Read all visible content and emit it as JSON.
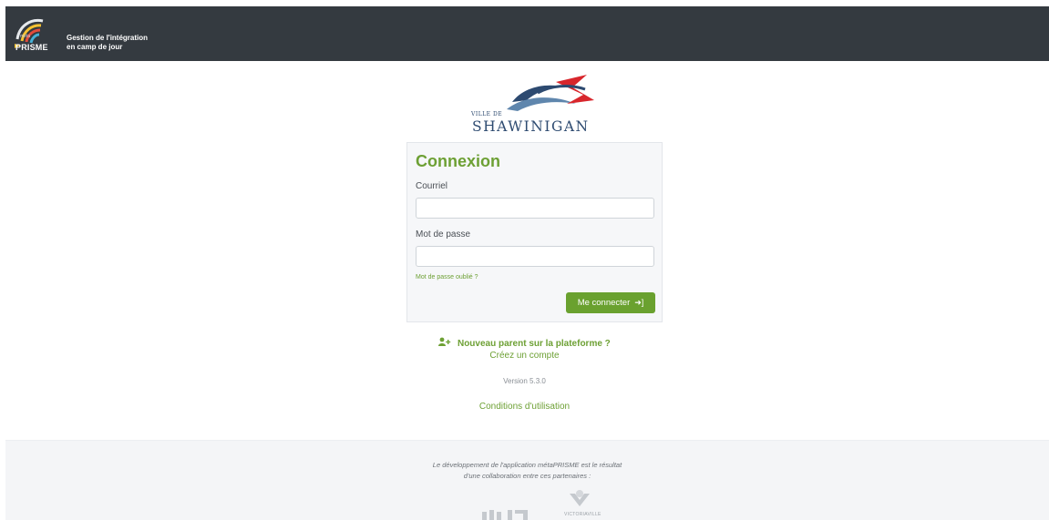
{
  "header": {
    "brand_meta": "méta",
    "brand_name": "PRISME",
    "title_line1": "Gestion de l'intégration",
    "title_line2": "en camp de jour",
    "logo_icon": "metaprisme-logo-icon"
  },
  "city": {
    "small": "VILLE DE",
    "name": "SHAWINIGAN",
    "colors": {
      "navy": "#2d4a70",
      "red": "#d8262c"
    }
  },
  "login": {
    "title": "Connexion",
    "email_label": "Courriel",
    "email_value": "",
    "password_label": "Mot de passe",
    "password_value": "",
    "forgot_link": "Mot de passe oublié ?",
    "submit_label": "Me connecter",
    "submit_icon": "sign-in-icon"
  },
  "register": {
    "heading": "Nouveau parent sur la plateforme ?",
    "heading_icon": "user-plus-icon",
    "link": "Créez un compte"
  },
  "version": "Version 5.3.0",
  "terms": "Conditions d'utilisation",
  "footer": {
    "line1": "Le développement de l'application métaPRISME est le résultat",
    "line2": "d'une collaboration entre ces partenaires :",
    "partner2_name": "VICTORIAVILLE"
  },
  "colors": {
    "accent": "#6da034",
    "header_bg": "#343a40",
    "button_bg": "#6aa12f"
  }
}
